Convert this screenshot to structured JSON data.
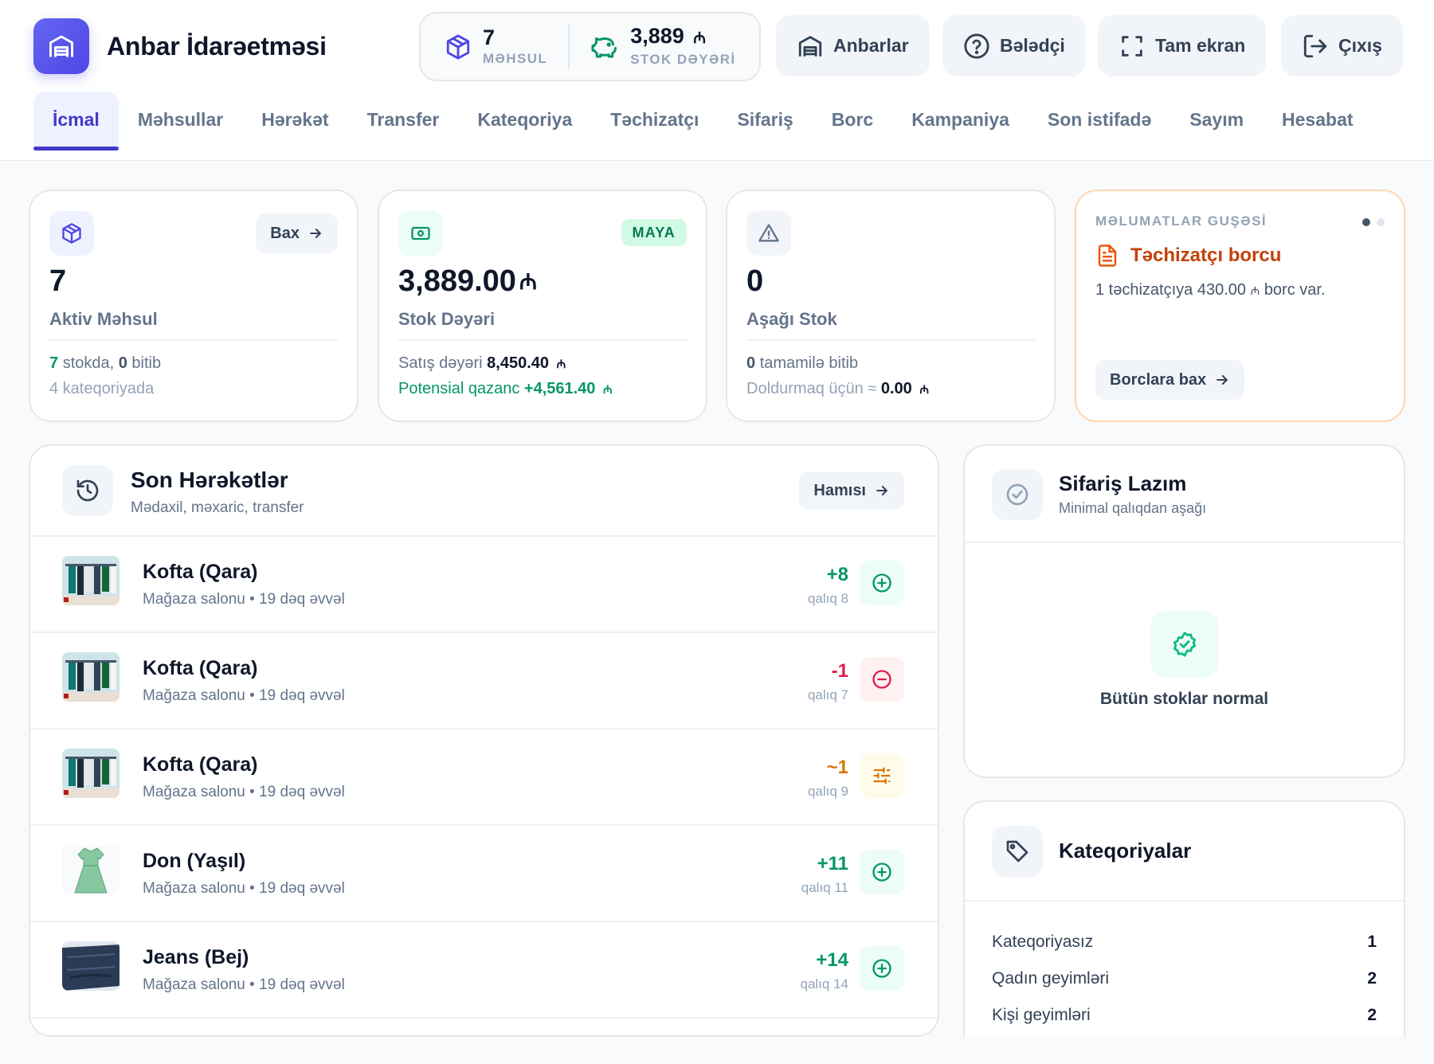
{
  "app": {
    "title": "Anbar İdarəetməsi",
    "logo_icon": "warehouse-icon",
    "accent": "#4f46e5"
  },
  "summary": {
    "products_value": "7",
    "products_label": "MƏHSUL",
    "stock_value": "3,889",
    "stock_currency": "₼",
    "stock_label": "STOK DƏYƏRİ"
  },
  "header_buttons": {
    "warehouses": "Anbarlar",
    "guide": "Bələdçi",
    "fullscreen": "Tam ekran",
    "logout": "Çıxış"
  },
  "tabs": [
    {
      "label": "İcmal",
      "active": true
    },
    {
      "label": "Məhsullar"
    },
    {
      "label": "Hərəkət"
    },
    {
      "label": "Transfer"
    },
    {
      "label": "Kateqoriya"
    },
    {
      "label": "Təchizatçı"
    },
    {
      "label": "Sifariş"
    },
    {
      "label": "Borc"
    },
    {
      "label": "Kampaniya"
    },
    {
      "label": "Son istifadə"
    },
    {
      "label": "Sayım"
    },
    {
      "label": "Hesabat"
    }
  ],
  "kpi": {
    "products": {
      "value": "7",
      "label": "Aktiv Məhsul",
      "view_button": "Bax",
      "in_stock_count": "7",
      "in_stock_text": "stokda,",
      "out_count": "0",
      "out_text": "bitib",
      "categories_text": "4 kateqoriyada"
    },
    "stock_value": {
      "value": "3,889.00",
      "currency": "₼",
      "label": "Stok Dəyəri",
      "badge": "MAYA",
      "sale_label": "Satış dəyəri",
      "sale_value": "8,450.40",
      "profit_label": "Potensial qazanc",
      "profit_value": "+4,561.40"
    },
    "low_stock": {
      "value": "0",
      "label": "Aşağı Stok",
      "out_count": "0",
      "out_text": "tamamilə bitib",
      "refill_label": "Doldurmaq üçün ≈",
      "refill_value": "0.00"
    },
    "info": {
      "kicker": "MƏLUMATLAR GUŞƏSİ",
      "title": "Təchizatçı borcu",
      "text_pre": "1 təchizatçıya 430.00",
      "text_post": "borc var.",
      "button": "Borclara bax"
    }
  },
  "recent_moves": {
    "title": "Son Hərəkətlər",
    "subtitle": "Mədaxil, məxaric, transfer",
    "all_button": "Hamısı",
    "rows": [
      {
        "name": "Kofta (Qara)",
        "meta": "Mağaza salonu • 19 dəq əvvəl",
        "delta": "+8",
        "rest": "qalıq 8",
        "type": "in"
      },
      {
        "name": "Kofta (Qara)",
        "meta": "Mağaza salonu • 19 dəq əvvəl",
        "delta": "-1",
        "rest": "qalıq 7",
        "type": "out"
      },
      {
        "name": "Kofta (Qara)",
        "meta": "Mağaza salonu • 19 dəq əvvəl",
        "delta": "~1",
        "rest": "qalıq 9",
        "type": "adjust"
      },
      {
        "name": "Don (Yaşıl)",
        "meta": "Mağaza salonu • 19 dəq əvvəl",
        "delta": "+11",
        "rest": "qalıq 11",
        "type": "in"
      },
      {
        "name": "Jeans (Bej)",
        "meta": "Mağaza salonu • 19 dəq əvvəl",
        "delta": "+14",
        "rest": "qalıq 14",
        "type": "in"
      }
    ]
  },
  "order_needed": {
    "title": "Sifariş Lazım",
    "subtitle": "Minimal qalıqdan aşağı",
    "empty_text": "Bütün stoklar normal"
  },
  "categories": {
    "title": "Kateqoriyalar",
    "rows": [
      {
        "name": "Kateqoriyasız",
        "count": "1"
      },
      {
        "name": "Qadın geyimləri",
        "count": "2"
      },
      {
        "name": "Kişi geyimləri",
        "count": "2"
      }
    ]
  }
}
